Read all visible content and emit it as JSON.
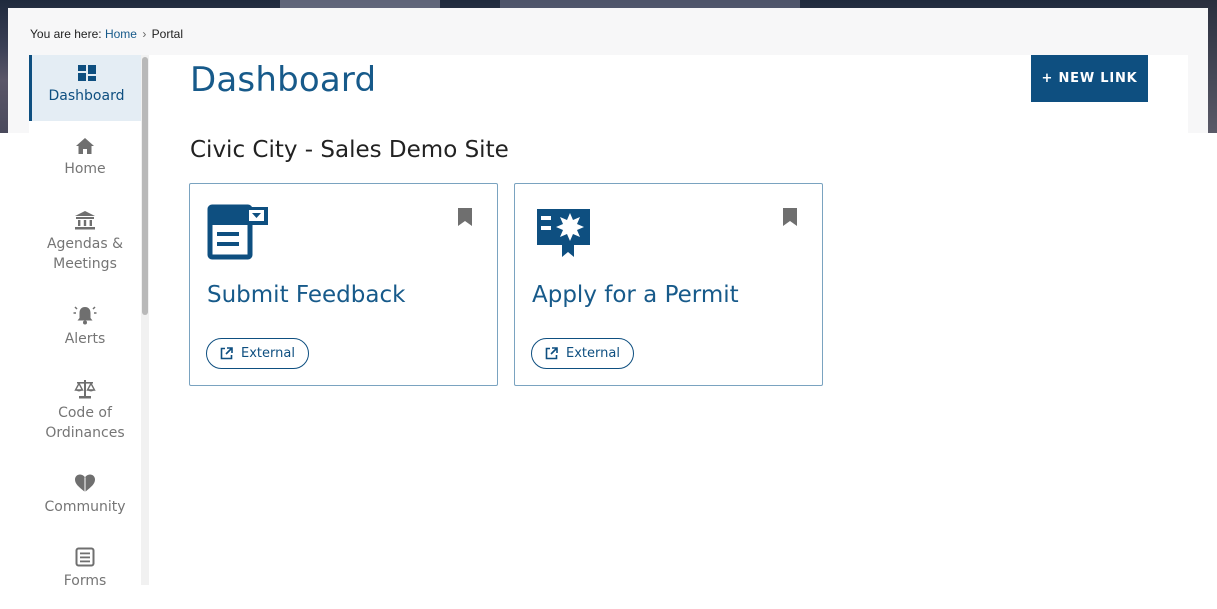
{
  "breadcrumb": {
    "prefix": "You are here:",
    "home": "Home",
    "separator": "›",
    "current": "Portal"
  },
  "sidebar": {
    "items": [
      {
        "label": "Dashboard",
        "icon": "dashboard-icon",
        "active": true
      },
      {
        "label": "Home",
        "icon": "home-icon"
      },
      {
        "label": "Agendas &",
        "label2": "Meetings",
        "icon": "government-building-icon"
      },
      {
        "label": "Alerts",
        "icon": "alert-bell-icon"
      },
      {
        "label": "Code of",
        "label2": "Ordinances",
        "icon": "scales-icon"
      },
      {
        "label": "Community",
        "icon": "heart-icon"
      },
      {
        "label": "Forms",
        "icon": "form-icon"
      }
    ]
  },
  "main": {
    "title": "Dashboard",
    "new_link_label": "+ NEW LINK",
    "site_title": "Civic City - Sales Demo Site",
    "cards": [
      {
        "title": "Submit Feedback",
        "icon": "feedback-form-icon",
        "badge": "External"
      },
      {
        "title": "Apply for a Permit",
        "icon": "permit-certificate-icon",
        "badge": "External"
      }
    ]
  },
  "colors": {
    "accent": "#0e4f80",
    "link": "#175a8a",
    "sidebar_active_bg": "#e4edf4",
    "card_border": "#7aa3c0"
  }
}
